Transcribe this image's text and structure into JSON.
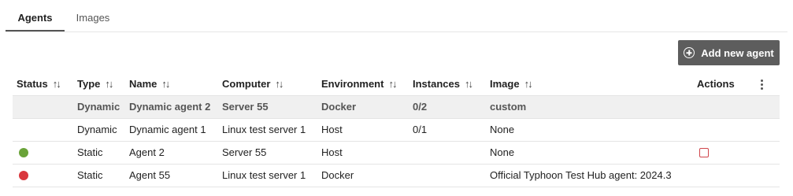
{
  "tabs": [
    {
      "label": "Agents",
      "active": true
    },
    {
      "label": "Images",
      "active": false
    }
  ],
  "add_button": {
    "label": "Add new agent",
    "icon": "plus-circle-icon"
  },
  "table": {
    "columns": [
      "Status",
      "Type",
      "Name",
      "Computer",
      "Environment",
      "Instances",
      "Image",
      "Actions"
    ],
    "sort_icon": "↑↓",
    "rows": [
      {
        "status": "",
        "type": "Dynamic",
        "name": "Dynamic agent 2",
        "computer": "Server 55",
        "environment": "Docker",
        "instances": "0/2",
        "image": "custom",
        "selected": true
      },
      {
        "status": "",
        "type": "Dynamic",
        "name": "Dynamic agent 1",
        "computer": "Linux test server 1",
        "environment": "Host",
        "instances": "0/1",
        "image": "None",
        "selected": false
      },
      {
        "status": "green",
        "type": "Static",
        "name": "Agent 2",
        "computer": "Server 55",
        "environment": "Host",
        "instances": "",
        "image": "None",
        "selected": false,
        "action_icon": "checkbox-icon"
      },
      {
        "status": "red",
        "type": "Static",
        "name": "Agent 55",
        "computer": "Linux test server 1",
        "environment": "Docker",
        "instances": "",
        "image": "Official Typhoon Test Hub agent: 2024.3",
        "selected": false
      }
    ]
  },
  "colors": {
    "status_green": "#6aa339",
    "status_red": "#d9373d",
    "button_bg": "#5d5d5d",
    "selected_row_bg": "#f0f0f0",
    "action_icon": "#d0454b"
  }
}
